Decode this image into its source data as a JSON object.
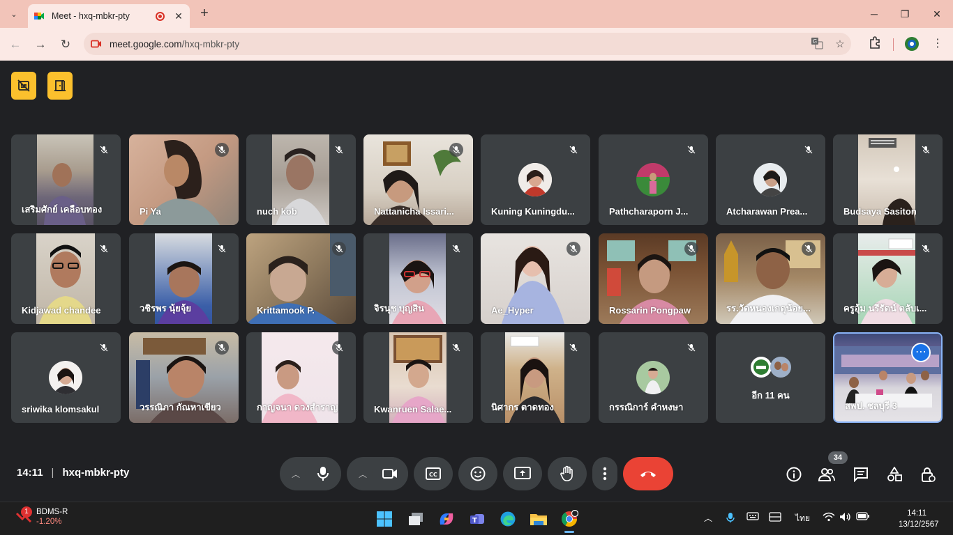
{
  "browser": {
    "tab": {
      "title": "Meet - hxq-mbkr-pty"
    },
    "url": {
      "host": "meet.google.com",
      "path": "/hxq-mbkr-pty"
    }
  },
  "grid": {
    "row1": [
      {
        "name": "เสริมศักย์ เคลือบทอง"
      },
      {
        "name": "Pi Ya"
      },
      {
        "name": "nuch kob"
      },
      {
        "name": "Nattanicha Issari..."
      },
      {
        "name": "Kuning Kuningdu..."
      },
      {
        "name": "Pathcharaporn J..."
      },
      {
        "name": "Atcharawan Prea..."
      },
      {
        "name": "Budsaya Sasiton"
      }
    ],
    "row2": [
      {
        "name": "Kidjawad chandee"
      },
      {
        "name": "วชิรพร นุ้ยจุ้ย"
      },
      {
        "name": "Krittamook P."
      },
      {
        "name": "จิรนุช บุญสิน"
      },
      {
        "name": "Ae_Hyper"
      },
      {
        "name": "Rossarin Pongpaw"
      },
      {
        "name": "รร.วัดหนองเกตุน้อย..."
      },
      {
        "name": "ครูอุ้ม นรีรัตน์ ตลับเ..."
      }
    ],
    "row3": [
      {
        "name": "sriwika klomsakul"
      },
      {
        "name": "วรรณิภา กัณหาเขียว"
      },
      {
        "name": "กาญจนา ดวงสำราญ"
      },
      {
        "name": "Kwanruen Salae..."
      },
      {
        "name": "นิศากร ตาดทอง"
      },
      {
        "name": "กรรณิการ์ คำหงษา"
      }
    ],
    "others": "อีก 11 คน",
    "self_name": "สพป. ชลบุรี 3"
  },
  "meeting": {
    "time": "14:11",
    "code": "hxq-mbkr-pty",
    "participants_count": "34"
  },
  "taskbar": {
    "stock_badge": "1",
    "stock_name": "BDMS-R",
    "stock_change": "-1.20%",
    "lang": "ไทย",
    "time": "14:11",
    "date": "13/12/2567"
  }
}
